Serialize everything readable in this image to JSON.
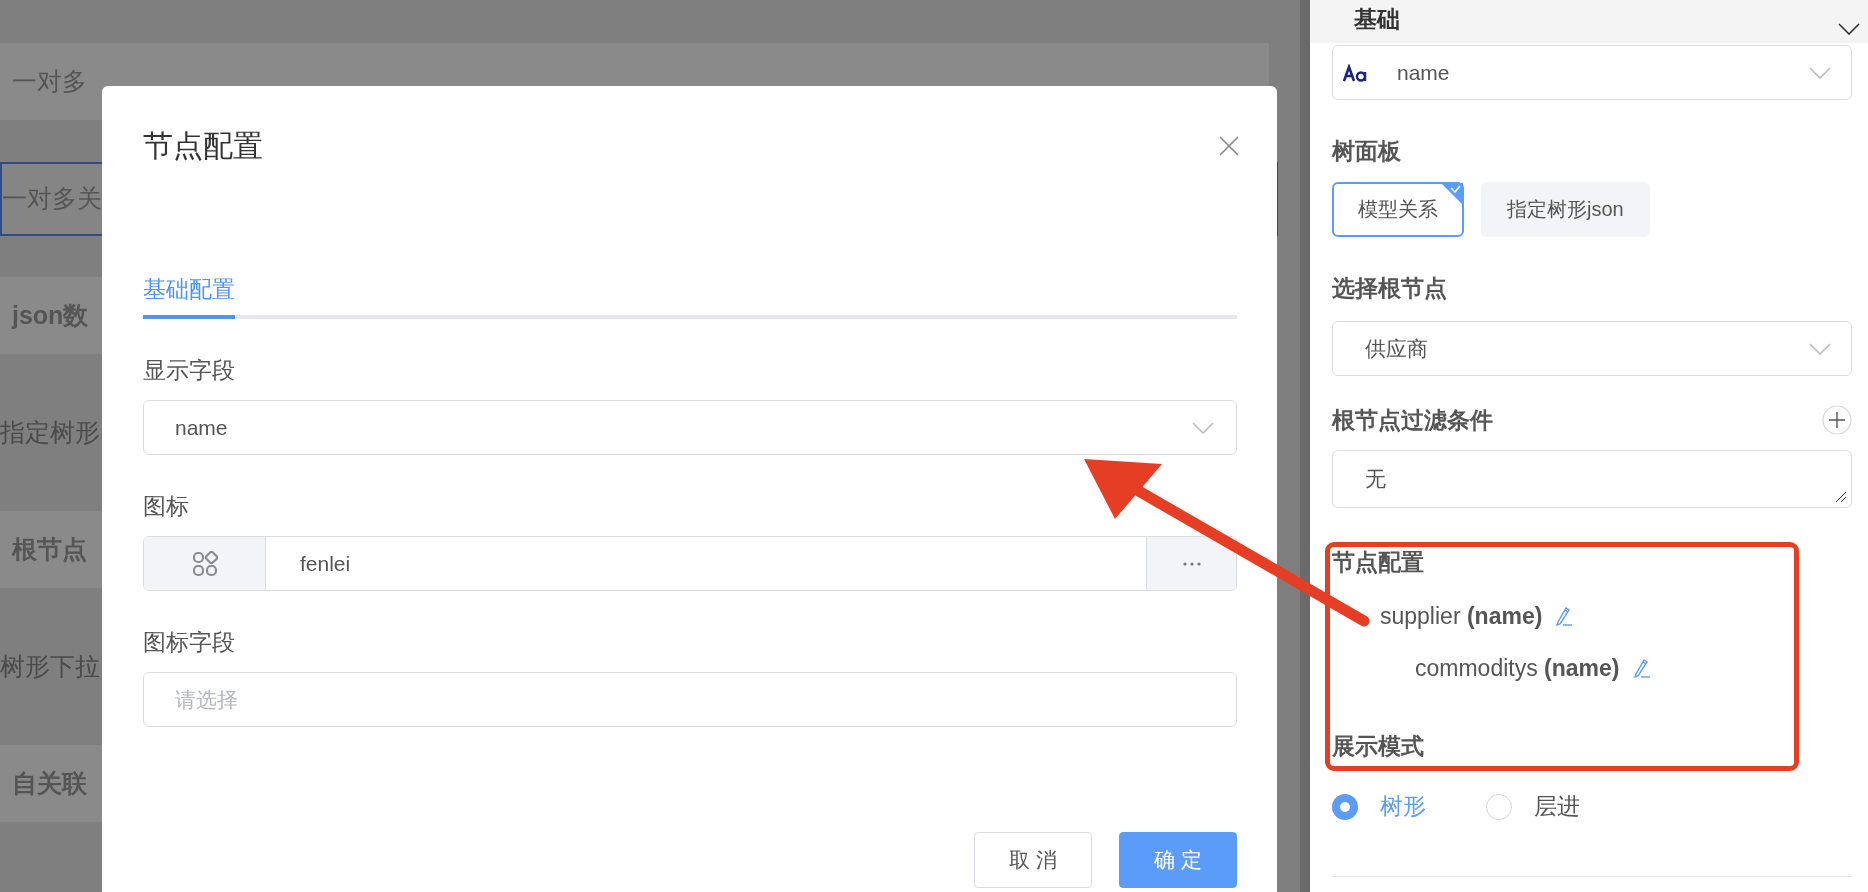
{
  "background_rows": [
    {
      "label": "一对多",
      "kind": "heading"
    },
    {
      "label": "一对多关",
      "kind": "input"
    },
    {
      "label": "json数",
      "kind": "section"
    },
    {
      "label": "指定树形",
      "kind": "plain"
    },
    {
      "label": "根节点",
      "kind": "section"
    },
    {
      "label": "树形下拉",
      "kind": "plain"
    },
    {
      "label": "自关联",
      "kind": "section"
    }
  ],
  "modal": {
    "title": "节点配置",
    "tabs": [
      {
        "label": "基础配置",
        "selected": true
      }
    ],
    "fields": [
      {
        "label": "显示字段",
        "kind": "select",
        "value": "name"
      },
      {
        "label": "图标",
        "kind": "icon",
        "value": "fenlei"
      },
      {
        "label": "图标字段",
        "kind": "input",
        "placeholder": "请选择"
      }
    ],
    "buttons": [
      {
        "label": "取 消",
        "kind": "default"
      },
      {
        "label": "确 定",
        "kind": "primary"
      }
    ]
  },
  "panel": {
    "section_title": "基础",
    "display_select": {
      "value": "name"
    },
    "tree_panel": {
      "label": "树面板",
      "options": [
        {
          "label": "模型关系",
          "selected": true
        },
        {
          "label": "指定树形json",
          "selected": false
        }
      ]
    },
    "root_node": {
      "label": "选择根节点",
      "value": "供应商"
    },
    "root_filter": {
      "label": "根节点过滤条件",
      "value": "无"
    },
    "node_config": {
      "label": "节点配置",
      "nodes": [
        {
          "text": "supplier **(name)**",
          "children": [
            {
              "text": "commoditys **(name)**"
            }
          ]
        }
      ]
    },
    "display_mode": {
      "label": "展示模式",
      "options": [
        {
          "label": "树形",
          "selected": true
        },
        {
          "label": "层进",
          "selected": false
        }
      ]
    }
  }
}
